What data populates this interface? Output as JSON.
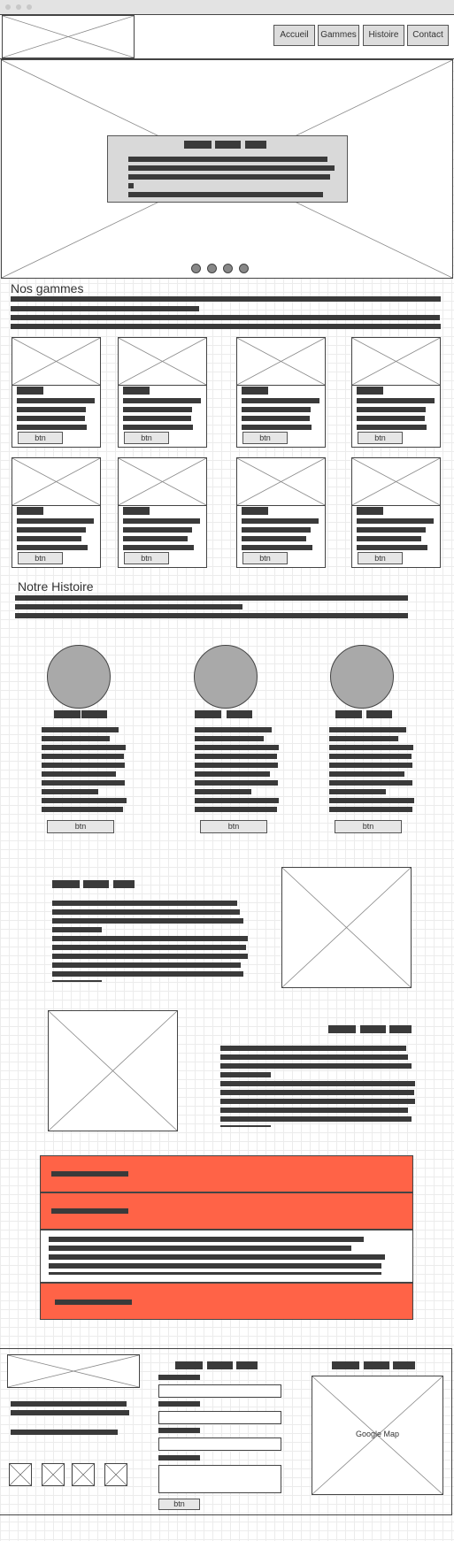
{
  "nav": {
    "items": [
      {
        "label": "Accueil"
      },
      {
        "label": "Gammes"
      },
      {
        "label": "Histoire"
      },
      {
        "label": "Contact"
      }
    ]
  },
  "sections": {
    "gammes_title": "Nos gammes",
    "histoire_title": "Notre Histoire"
  },
  "cards": {
    "button_label": "btn",
    "count": 8
  },
  "team": {
    "button_label": "btn"
  },
  "footer": {
    "map_label": "Google Map",
    "form_button_label": "btn"
  },
  "colors": {
    "accent": "#ff6347",
    "wireframe_gray": "#3a3a3a",
    "circle_gray": "#a9a9a9"
  }
}
